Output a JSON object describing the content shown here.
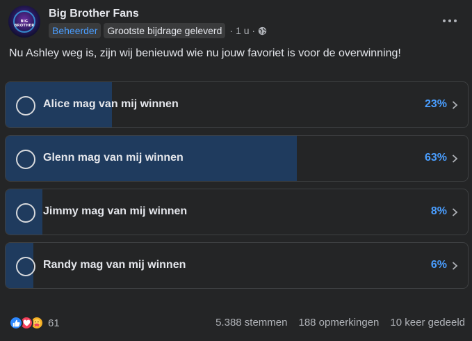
{
  "post": {
    "group_name": "Big Brother Fans",
    "avatar_text": "BIG BROTHER",
    "badges": {
      "admin": "Beheerder",
      "contributor": "Grootste bijdrage geleverd"
    },
    "separator": "·",
    "time": "1 u ·",
    "question": "Nu Ashley weg is, zijn wij benieuwd wie nu jouw favoriet is voor de overwinning!"
  },
  "poll": {
    "options": [
      {
        "label": "Alice mag van mij winnen",
        "percent_label": "23%",
        "share": 0.23
      },
      {
        "label": "Glenn mag van mij winnen",
        "percent_label": "63%",
        "share": 0.63
      },
      {
        "label": "Jimmy mag van mij winnen",
        "percent_label": "8%",
        "share": 0.08
      },
      {
        "label": "Randy mag van mij winnen",
        "percent_label": "6%",
        "share": 0.06
      }
    ]
  },
  "footer": {
    "reaction_count": "61",
    "reactions": [
      "like-icon",
      "love-icon",
      "care-icon"
    ],
    "votes": "5.388 stemmen",
    "comments": "188 opmerkingen",
    "shares": "10 keer gedeeld"
  },
  "colors": {
    "background": "#242526",
    "accent": "#4a9eff",
    "poll_fill": "#1f3b5e",
    "text_primary": "#e4e6eb",
    "text_secondary": "#b0b3b8"
  }
}
